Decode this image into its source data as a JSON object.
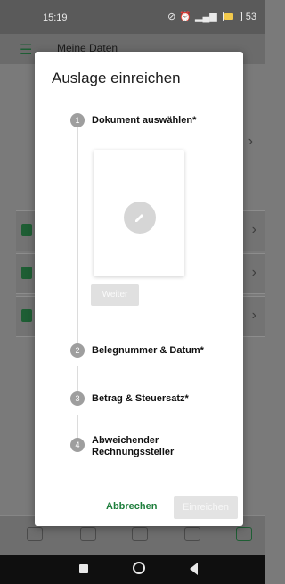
{
  "status_bar": {
    "time": "15:19",
    "battery": "53"
  },
  "app_bar": {
    "title": "Meine Daten"
  },
  "dialog": {
    "title": "Auslage einreichen",
    "steps": [
      {
        "number": "1",
        "label": "Dokument auswählen*"
      },
      {
        "number": "2",
        "label": "Belegnummer & Datum*"
      },
      {
        "number": "3",
        "label": "Betrag & Steuersatz*"
      },
      {
        "number": "4",
        "label": "Abweichender Rechnungssteller"
      }
    ],
    "next_button": "Weiter",
    "cancel_button": "Abbrechen",
    "submit_button": "Einreichen"
  },
  "colors": {
    "accent": "#1e7e3c",
    "step_circle": "#9e9e9e",
    "disabled_button": "#e0e0e0"
  }
}
